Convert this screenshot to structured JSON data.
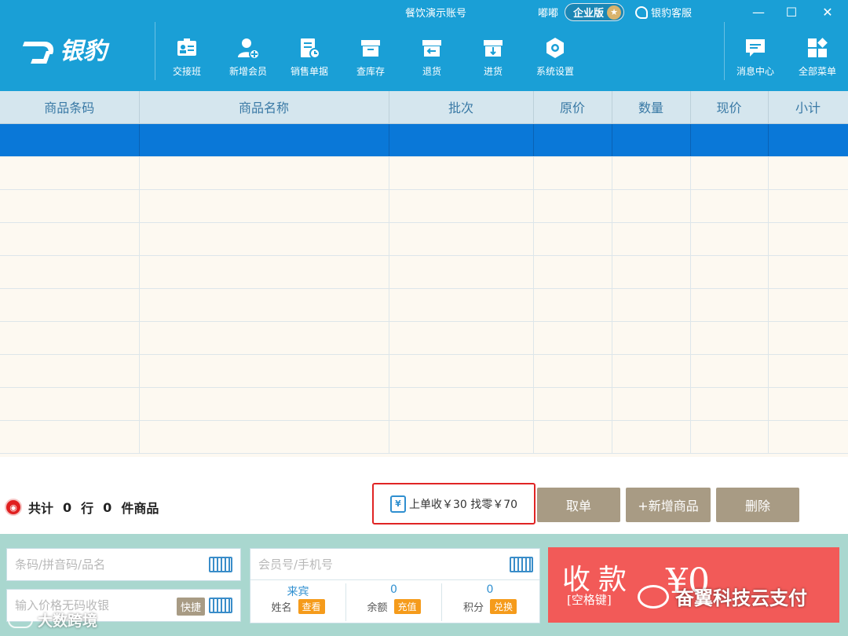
{
  "window": {
    "title": "餐饮演示账号",
    "user": "嘟嘟",
    "edition": "企业版",
    "support": "银豹客服",
    "minimize": "—",
    "maximize": "☐",
    "close": "✕"
  },
  "brand": {
    "name": "银豹"
  },
  "toolbar": [
    {
      "label": "交接班",
      "icon": "handover-icon"
    },
    {
      "label": "新增会员",
      "icon": "add-member-icon"
    },
    {
      "label": "销售单据",
      "icon": "sales-document-icon"
    },
    {
      "label": "查库存",
      "icon": "inventory-icon"
    },
    {
      "label": "退货",
      "icon": "return-icon"
    },
    {
      "label": "进货",
      "icon": "purchase-icon"
    },
    {
      "label": "系统设置",
      "icon": "settings-icon"
    },
    {
      "label": "消息中心",
      "icon": "message-icon"
    },
    {
      "label": "全部菜单",
      "icon": "all-menu-icon"
    }
  ],
  "table": {
    "columns": [
      "商品条码",
      "商品名称",
      "批次",
      "原价",
      "数量",
      "现价",
      "小计"
    ],
    "rows": 10
  },
  "summary": {
    "total_prefix": "共计",
    "rows_count": "0",
    "rows_unit": "行",
    "items_count": "0",
    "items_unit": "件商品",
    "last_order": "上单收￥30 找零￥70",
    "yen_symbol": "¥"
  },
  "actions": {
    "cancel": "取单",
    "add_product": "+新增商品",
    "delete": "删除"
  },
  "inputs": {
    "barcode_placeholder": "条码/拼音码/品名",
    "price_placeholder": "输入价格无码收银",
    "shortcut": "快捷",
    "member_placeholder": "会员号/手机号"
  },
  "member": {
    "guest": "来宾",
    "name_label": "姓名",
    "view": "查看",
    "balance_value": "0",
    "balance_label": "余额",
    "recharge": "充值",
    "points_value": "0",
    "points_label": "积分",
    "exchange": "兑换"
  },
  "pay": {
    "label": "收款",
    "key_hint": "[空格键]",
    "amount": "¥0"
  },
  "watermarks": {
    "right": "奋翼科技云支付",
    "left": "大数跨境"
  },
  "colors": {
    "header": "#1a9fd6",
    "selected_row": "#0a78d8",
    "pay": "#f25a58",
    "bottom_panel": "#a9d7cf",
    "action_button": "#a89b84"
  }
}
